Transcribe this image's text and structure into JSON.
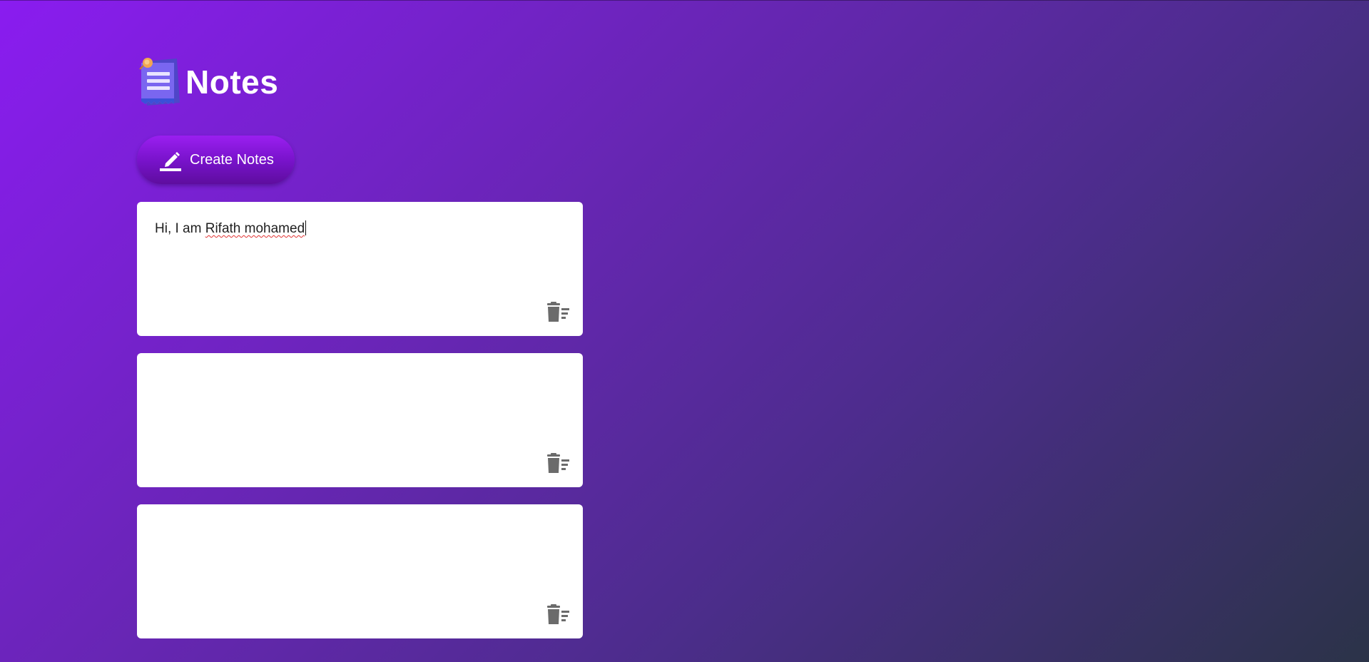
{
  "app": {
    "title": "Notes",
    "logo_icon": "notepad-icon"
  },
  "toolbar": {
    "create_label": "Create Notes",
    "create_icon": "pencil-icon"
  },
  "notes": [
    {
      "text_before": "Hi, I am ",
      "text_misspelled": "Rifath mohamed",
      "delete_icon": "delete-sweep-icon"
    },
    {
      "text_before": "",
      "text_misspelled": "",
      "delete_icon": "delete-sweep-icon"
    },
    {
      "text_before": "",
      "text_misspelled": "",
      "delete_icon": "delete-sweep-icon"
    }
  ],
  "colors": {
    "gradient_start": "#8a1cf0",
    "gradient_end": "#2b3348",
    "button": "#7612c8",
    "note_bg": "#ffffff",
    "icon_gray": "#6b6b6b"
  }
}
